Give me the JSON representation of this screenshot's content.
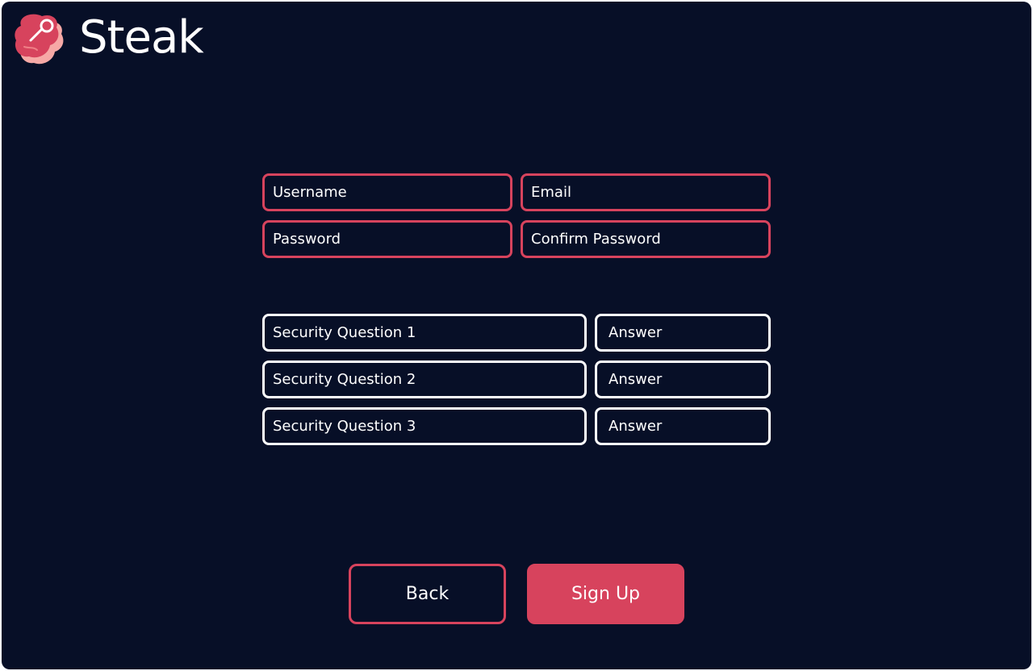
{
  "app": {
    "name": "Steak",
    "accent_color": "#d7435d",
    "background_color": "#070f27",
    "logo_icon": "steak-icon"
  },
  "account_fields": {
    "username_placeholder": "Username",
    "email_placeholder": "Email",
    "password_placeholder": "Password",
    "confirm_password_placeholder": "Confirm Password"
  },
  "security_questions": [
    {
      "question_placeholder": "Security Question 1",
      "answer_placeholder": "Answer"
    },
    {
      "question_placeholder": "Security Question 2",
      "answer_placeholder": "Answer"
    },
    {
      "question_placeholder": "Security Question 3",
      "answer_placeholder": "Answer"
    }
  ],
  "actions": {
    "back_label": "Back",
    "signup_label": "Sign Up"
  }
}
